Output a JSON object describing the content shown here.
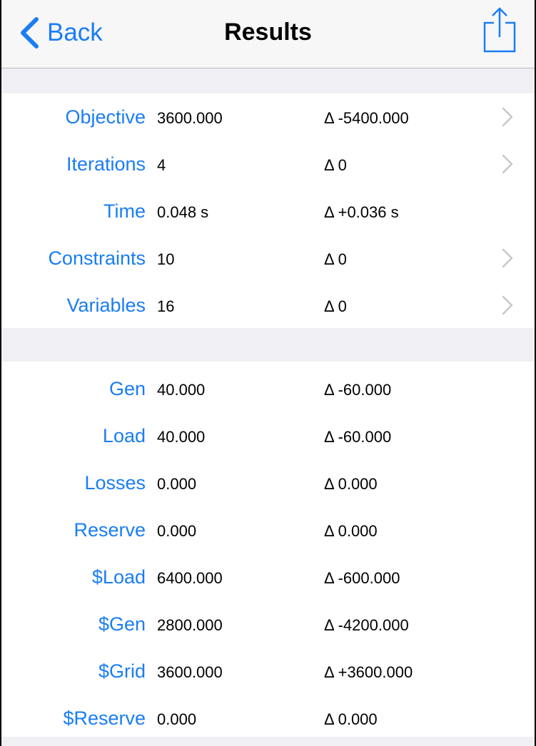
{
  "navbar": {
    "back_label": "Back",
    "title": "Results"
  },
  "colors": {
    "accent": "#1a7df5",
    "background": "#efeff4",
    "chevron": "#c7c7cc"
  },
  "icons": {
    "back": "chevron-left-icon",
    "share": "share-icon",
    "disclosure": "chevron-right-icon"
  },
  "summary": [
    {
      "label": "Objective",
      "value": "3600.000",
      "delta": "Δ -5400.000",
      "has_disclosure": true
    },
    {
      "label": "Iterations",
      "value": "4",
      "delta": "Δ 0",
      "has_disclosure": true
    },
    {
      "label": "Time",
      "value": "0.048 s",
      "delta": "Δ +0.036 s",
      "has_disclosure": false
    },
    {
      "label": "Constraints",
      "value": "10",
      "delta": "Δ 0",
      "has_disclosure": true
    },
    {
      "label": "Variables",
      "value": "16",
      "delta": "Δ 0",
      "has_disclosure": true
    }
  ],
  "details": [
    {
      "label": "Gen",
      "value": "40.000",
      "delta": "Δ -60.000"
    },
    {
      "label": "Load",
      "value": "40.000",
      "delta": "Δ -60.000"
    },
    {
      "label": "Losses",
      "value": "0.000",
      "delta": "Δ 0.000"
    },
    {
      "label": "Reserve",
      "value": "0.000",
      "delta": "Δ 0.000"
    },
    {
      "label": "$Load",
      "value": "6400.000",
      "delta": "Δ -600.000"
    },
    {
      "label": "$Gen",
      "value": "2800.000",
      "delta": "Δ -4200.000"
    },
    {
      "label": "$Grid",
      "value": "3600.000",
      "delta": "Δ +3600.000"
    },
    {
      "label": "$Reserve",
      "value": "0.000",
      "delta": "Δ 0.000"
    }
  ]
}
